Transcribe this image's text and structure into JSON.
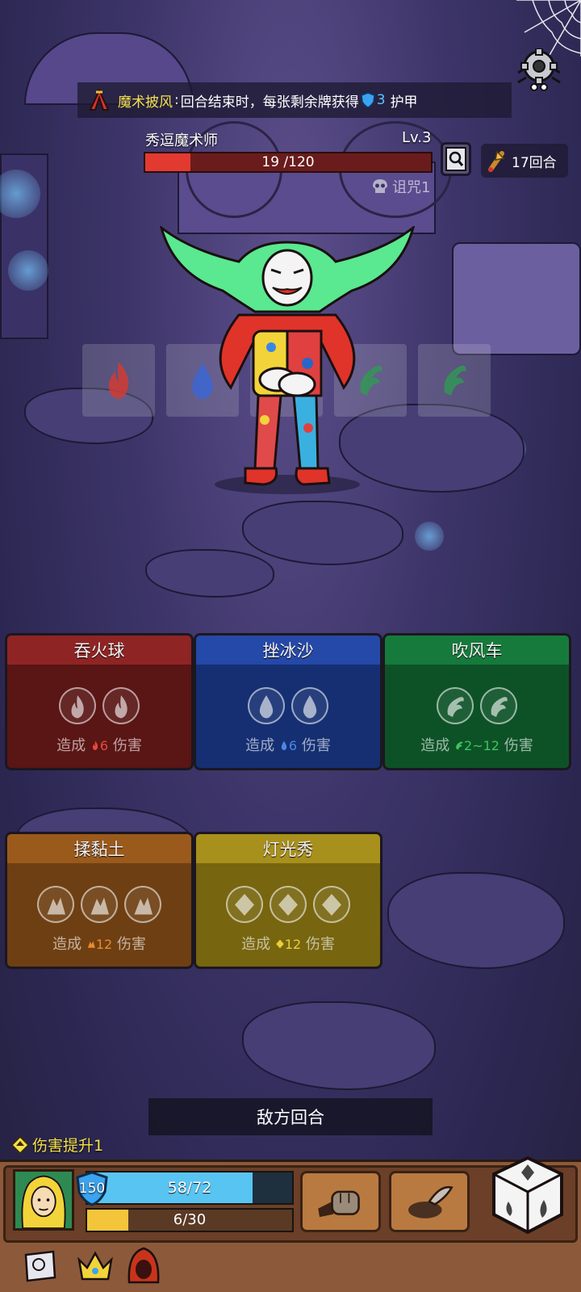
{
  "relic": {
    "name": "魔术披风",
    "colon": ":",
    "desc_before": "回合结束时，每张剩余牌获得",
    "armor_value": "3",
    "desc_after": "护甲"
  },
  "enemy": {
    "name": "秀逗魔术师",
    "level": "Lv.3",
    "hp_current": 19,
    "hp_max": 120,
    "hp_text": "19 /120",
    "curse": "诅咒1"
  },
  "round": {
    "label": "17回合"
  },
  "intents": [
    "fire-icon",
    "water-icon",
    "wind-icon",
    "wind-icon",
    "wind-icon"
  ],
  "cards": [
    {
      "title": "吞火球",
      "element": "fire",
      "slots": 2,
      "desc_pre": "造成",
      "value": "6",
      "desc_post": "伤害",
      "head_color": "#8f2424",
      "body_color": "#5a1515",
      "value_color": "#e84a3c"
    },
    {
      "title": "挫冰沙",
      "element": "water",
      "slots": 2,
      "desc_pre": "造成",
      "value": "6",
      "desc_post": "伤害",
      "head_color": "#2549a8",
      "body_color": "#152f72",
      "value_color": "#4b86e8"
    },
    {
      "title": "吹风车",
      "element": "wind",
      "slots": 2,
      "desc_pre": "造成",
      "value": "2~12",
      "desc_post": "伤害",
      "head_color": "#167a3c",
      "body_color": "#0d5227",
      "value_color": "#3ec45e"
    },
    {
      "title": "揉黏土",
      "element": "earth",
      "slots": 3,
      "desc_pre": "造成",
      "value": "12",
      "desc_post": "伤害",
      "head_color": "#9a5a1c",
      "body_color": "#6e3f12",
      "value_color": "#e88a30"
    },
    {
      "title": "灯光秀",
      "element": "light",
      "slots": 3,
      "desc_pre": "造成",
      "value": "12",
      "desc_post": "伤害",
      "head_color": "#a8901c",
      "body_color": "#77650f",
      "value_color": "#e8cf3a"
    }
  ],
  "turn": {
    "label": "敌方回合"
  },
  "buff": {
    "label": "伤害提升1"
  },
  "player": {
    "armor": "150",
    "hp_current": 58,
    "hp_max": 72,
    "hp_text": "58/72",
    "xp_current": 6,
    "xp_max": 30,
    "xp_text": "6/30"
  },
  "items": [
    "scroll-icon",
    "crown-icon",
    "hood-icon"
  ],
  "skills": [
    "punch-skill-icon",
    "dig-skill-icon"
  ]
}
